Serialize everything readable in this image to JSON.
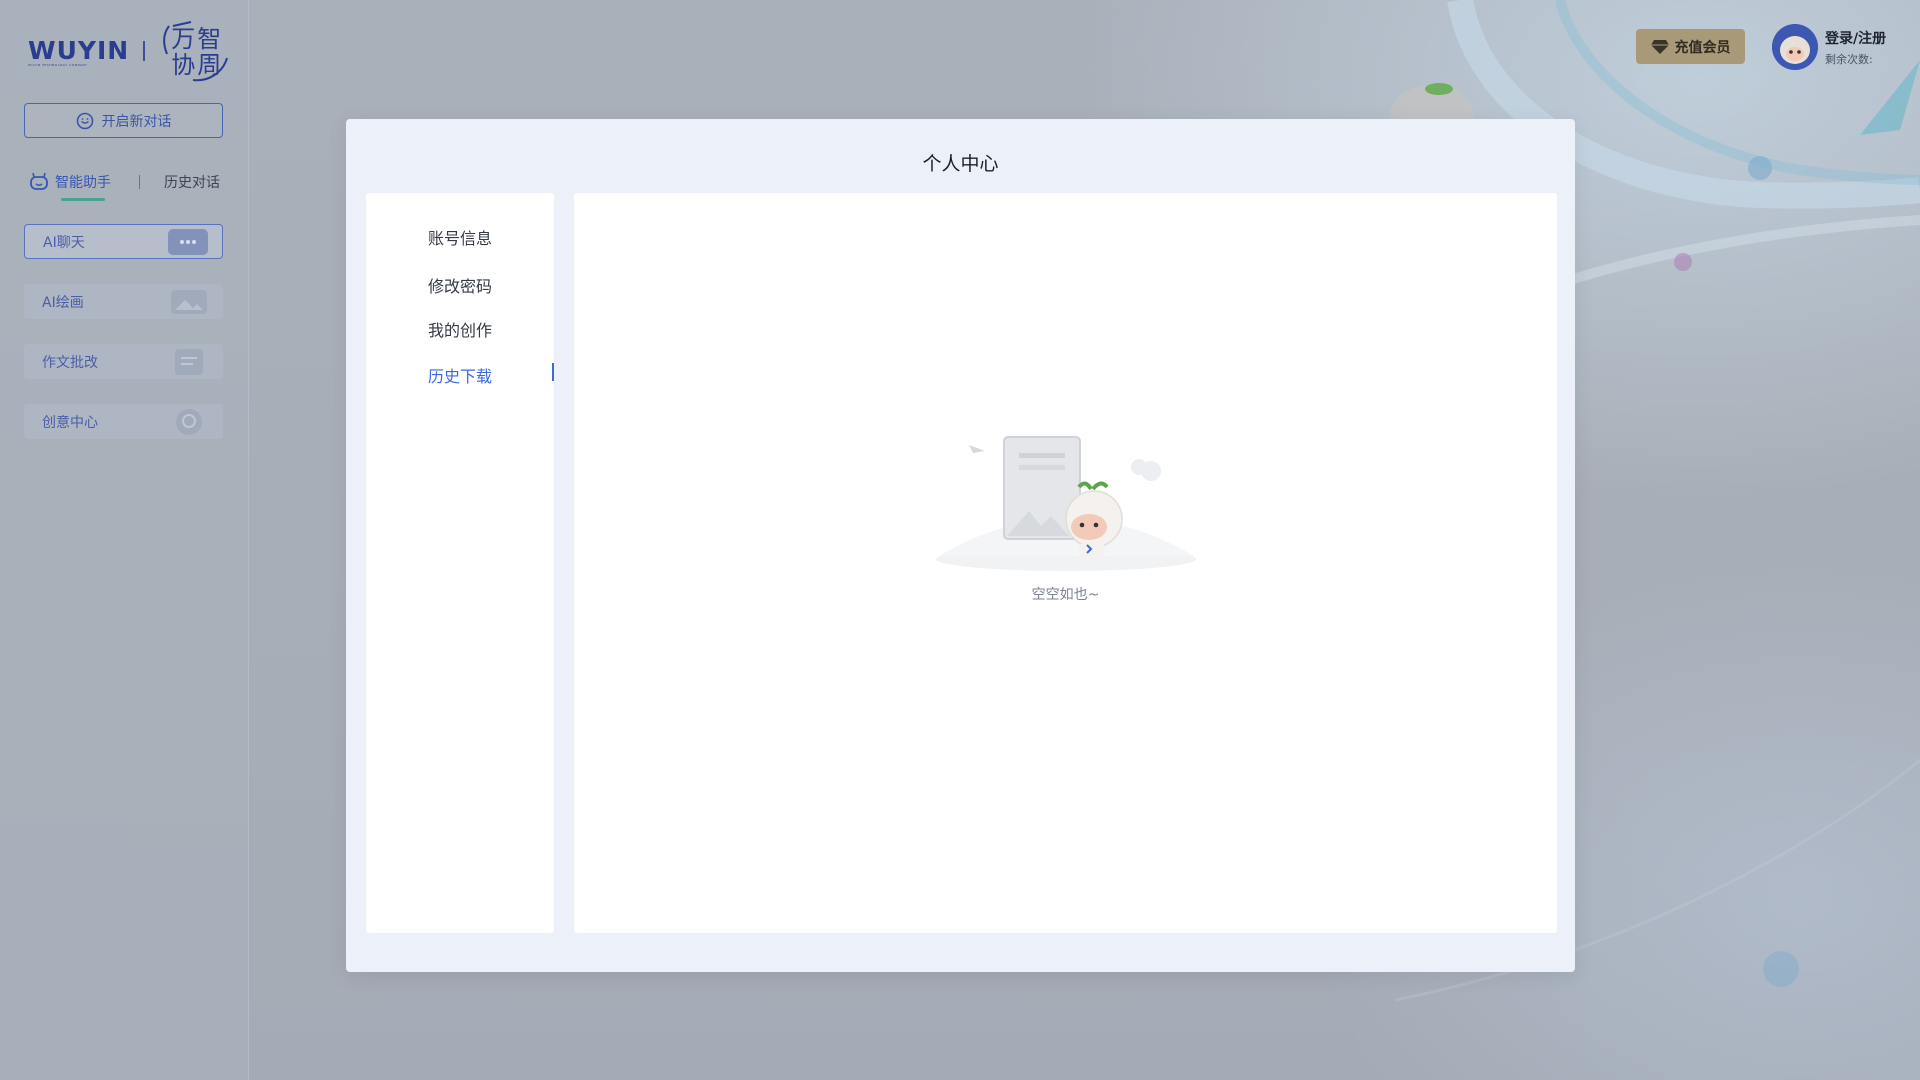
{
  "brand": {
    "logo_text": "WUYIN",
    "logo_subtext": "WUYIN TECHNOLOGY COMPANY",
    "mark_chars": [
      "万",
      "智",
      "协",
      "周"
    ]
  },
  "sidebar": {
    "new_chat_label": "开启新对话",
    "tabs": {
      "assistant": "智能助手",
      "history": "历史对话"
    },
    "items": [
      {
        "label": "AI聊天",
        "icon": "chat-bubble-icon",
        "active": true
      },
      {
        "label": "AI绘画",
        "icon": "picture-icon",
        "active": false
      },
      {
        "label": "作文批改",
        "icon": "document-icon",
        "active": false
      },
      {
        "label": "创意中心",
        "icon": "bulb-icon",
        "active": false
      }
    ]
  },
  "topbar": {
    "vip_label": "充值会员",
    "login_label": "登录/注册",
    "remaining_label": "剩余次数:"
  },
  "modal": {
    "title": "个人中心",
    "nav": [
      {
        "label": "账号信息",
        "active": false
      },
      {
        "label": "修改密码",
        "active": false
      },
      {
        "label": "我的创作",
        "active": false
      },
      {
        "label": "历史下载",
        "active": true
      }
    ],
    "empty_text": "空空如也~"
  },
  "colors": {
    "accent": "#3b6ae0",
    "sidebar_text": "#3c55a8",
    "vip_bg": "#a89a78"
  }
}
